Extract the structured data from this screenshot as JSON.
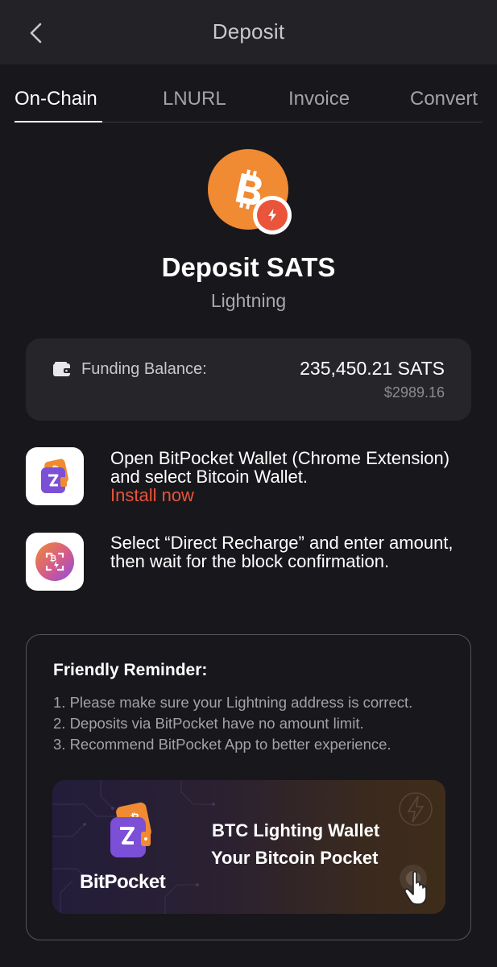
{
  "header": {
    "title": "Deposit",
    "back_icon": "chevron-left-icon"
  },
  "tabs": [
    {
      "label": "On-Chain",
      "active": true
    },
    {
      "label": "LNURL",
      "active": false
    },
    {
      "label": "Invoice",
      "active": false
    },
    {
      "label": "Convert",
      "active": false
    }
  ],
  "hero": {
    "icon": "bitcoin-coin-icon",
    "badge_icon": "lightning-badge-icon",
    "title": "Deposit SATS",
    "subtitle": "Lightning"
  },
  "balance": {
    "icon": "wallet-icon",
    "label": "Funding Balance:",
    "amount": "235,450.21 SATS",
    "usd": "$2989.16"
  },
  "steps": [
    {
      "icon": "bitpocket-wallet-icon",
      "text": "Open BitPocket Wallet (Chrome Extension) and select Bitcoin Wallet.",
      "link": "Install now"
    },
    {
      "icon": "direct-recharge-icon",
      "text": "Select “Direct Recharge” and enter amount, then wait for the block confirmation."
    }
  ],
  "reminder": {
    "title": "Friendly Reminder:",
    "items": [
      "1. Please make sure your Lightning address is correct.",
      "2. Deposits via BitPocket have no amount limit.",
      "3. Recommend BitPocket App to better experience."
    ]
  },
  "banner": {
    "brand": "BitPocket",
    "line1": "BTC Lighting Wallet",
    "line2": "Your Bitcoin Pocket",
    "cursor_icon": "hand-pointer-icon"
  },
  "colors": {
    "background": "#18171b",
    "header": "#232227",
    "card": "#262529",
    "accent_orange": "#f08a33",
    "link_red": "#e9543a",
    "purple": "#7b4fd6"
  }
}
